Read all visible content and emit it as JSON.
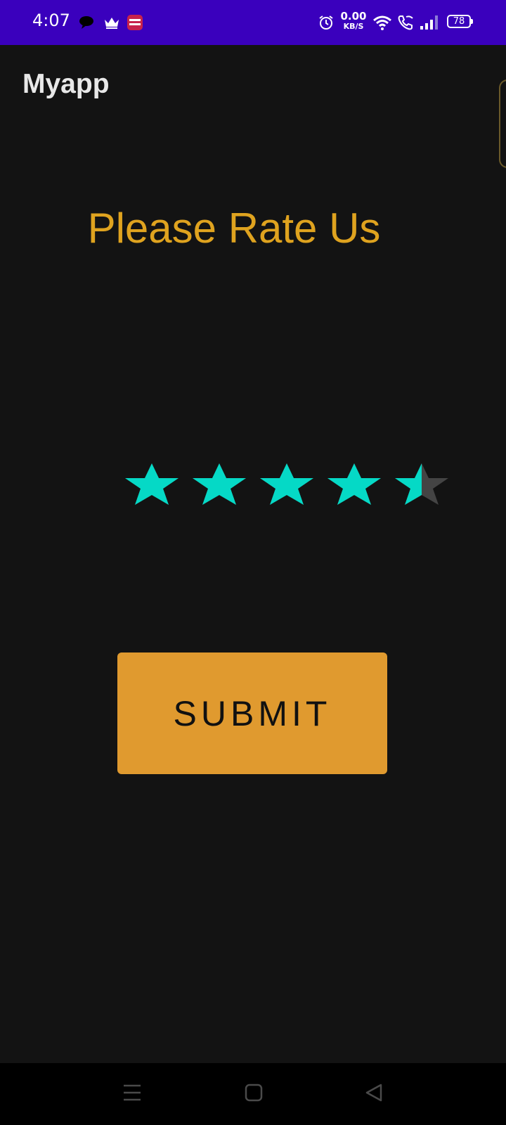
{
  "status_bar": {
    "time": "4:07",
    "net_speed_value": "0.00",
    "net_speed_unit": "KB/S",
    "battery_level": "78",
    "notification_icons": [
      "chat-bubble-icon",
      "crown-icon",
      "yono-sbi-app-icon"
    ],
    "system_icons": [
      "alarm-icon",
      "wifi-icon",
      "wifi-calling-icon",
      "cellular-signal-icon",
      "battery-icon"
    ],
    "background_color": "#3a00bd"
  },
  "app_bar": {
    "title": "Myapp"
  },
  "main": {
    "heading": "Please Rate Us",
    "rating": {
      "value": 4.5,
      "max": 5,
      "filled_color": "#05d9c6",
      "empty_color": "#444444"
    },
    "submit_label": "SUBMIT"
  },
  "colors": {
    "background": "#131313",
    "heading": "#dfa31f",
    "button": "#e09a2f"
  },
  "nav_bar": {
    "buttons": [
      "menu-icon",
      "home-icon",
      "back-icon"
    ]
  }
}
